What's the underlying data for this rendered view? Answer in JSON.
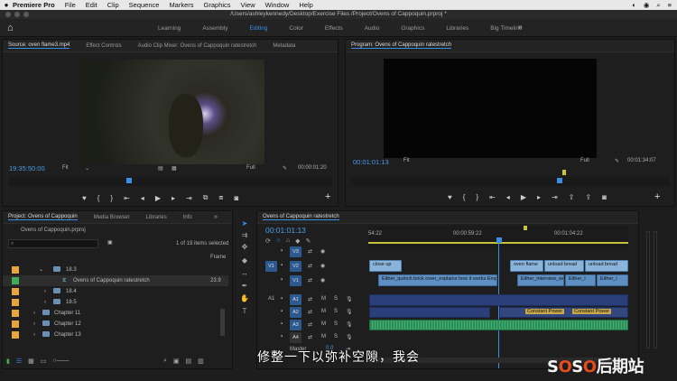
{
  "menubar": {
    "apple": "",
    "app": "Premiere Pro",
    "items": [
      "File",
      "Edit",
      "Clip",
      "Sequence",
      "Markers",
      "Graphics",
      "View",
      "Window",
      "Help"
    ],
    "status_icons": [
      "◐",
      "◉",
      "⌕",
      "≡"
    ]
  },
  "titlebar": {
    "path": "/Users/ashleykennedy/Desktop/Exercise Files /Project/Ovens of Cappoquin.prproj *"
  },
  "workspace": {
    "home_icon": "⌂",
    "tabs": [
      "Learning",
      "Assembly",
      "Editing",
      "Color",
      "Effects",
      "Audio",
      "Graphics",
      "Libraries",
      "Big Timeline"
    ],
    "active": "Editing",
    "more": "»"
  },
  "source": {
    "tabs": [
      "Source: oven flame3.mp4",
      "Effect Controls",
      "Audio Clip Mixer: Ovens of Cappoquin ratestretch",
      "Metadata"
    ],
    "timecode": "19:35:50:00",
    "fit": "Fit",
    "quality": "Full",
    "duration": "00:00:01:20"
  },
  "program": {
    "tabs": [
      "Program: Ovens of Cappoquin ratestretch"
    ],
    "timecode": "00:01:01:13",
    "fit": "Fit",
    "quality": "Full",
    "duration": "00:01:34:07"
  },
  "project": {
    "tabs": [
      "Project: Ovens of Cappoquin",
      "Media Browser",
      "Libraries",
      "Info"
    ],
    "filename": "Ovens of Cappoquin.prproj",
    "selected": "1 of 19 items selected",
    "column_label": "Frame",
    "rows": [
      {
        "name": "18.3",
        "type": "folder",
        "color": "#e8a33a",
        "open": true
      },
      {
        "name": "Ovens of Cappoquin ratestretch",
        "type": "sequence",
        "color": "#3fae5a",
        "value": "23.9"
      },
      {
        "name": "18.4",
        "type": "folder",
        "color": "#e8a33a"
      },
      {
        "name": "18.5",
        "type": "folder",
        "color": "#e8a33a"
      },
      {
        "name": "Chapter 11",
        "type": "folder",
        "color": "#e8a33a"
      },
      {
        "name": "Chapter 12",
        "type": "folder",
        "color": "#e8a33a"
      },
      {
        "name": "Chapter 13",
        "type": "folder",
        "color": "#e8a33a"
      }
    ]
  },
  "timeline": {
    "tab": "Ovens of Cappoquin ratestretch",
    "timecode": "00:01:01:13",
    "ruler": [
      "54:22",
      "00:00:59:22",
      "00:01:04:22"
    ],
    "tracks": [
      {
        "label": "V3",
        "src": ""
      },
      {
        "label": "V2",
        "src": "V1"
      },
      {
        "label": "V1",
        "src": ""
      },
      {
        "label": "A1",
        "src": "A1",
        "m": "M",
        "s": "S"
      },
      {
        "label": "A2",
        "src": "",
        "m": "M",
        "s": "S"
      },
      {
        "label": "A3",
        "src": "",
        "m": "M",
        "s": "S"
      },
      {
        "label": "A4",
        "src": "",
        "m": "M",
        "s": "S"
      }
    ],
    "master_label": "Master",
    "master_value": "0.0",
    "clips_v2": [
      "close up",
      "oven flame",
      "unload bread",
      "unload bread"
    ],
    "clips_v1": [
      "Either_quinch brick oven_explains how it works Emphasis on fireplace1 mp4",
      "Either_interview_wo",
      "Either_i",
      "Either_i"
    ],
    "audio_labels": [
      "Constant Power",
      "Constant Power"
    ]
  },
  "subtitle": "修整一下以弥补空隙，我会",
  "watermark": {
    "a": "S",
    "b": "O",
    "c": "S",
    "d": "O",
    "rest": "后期站"
  },
  "colors": {
    "accent": "#3a8ee6",
    "timecode": "#4a9ee8"
  }
}
